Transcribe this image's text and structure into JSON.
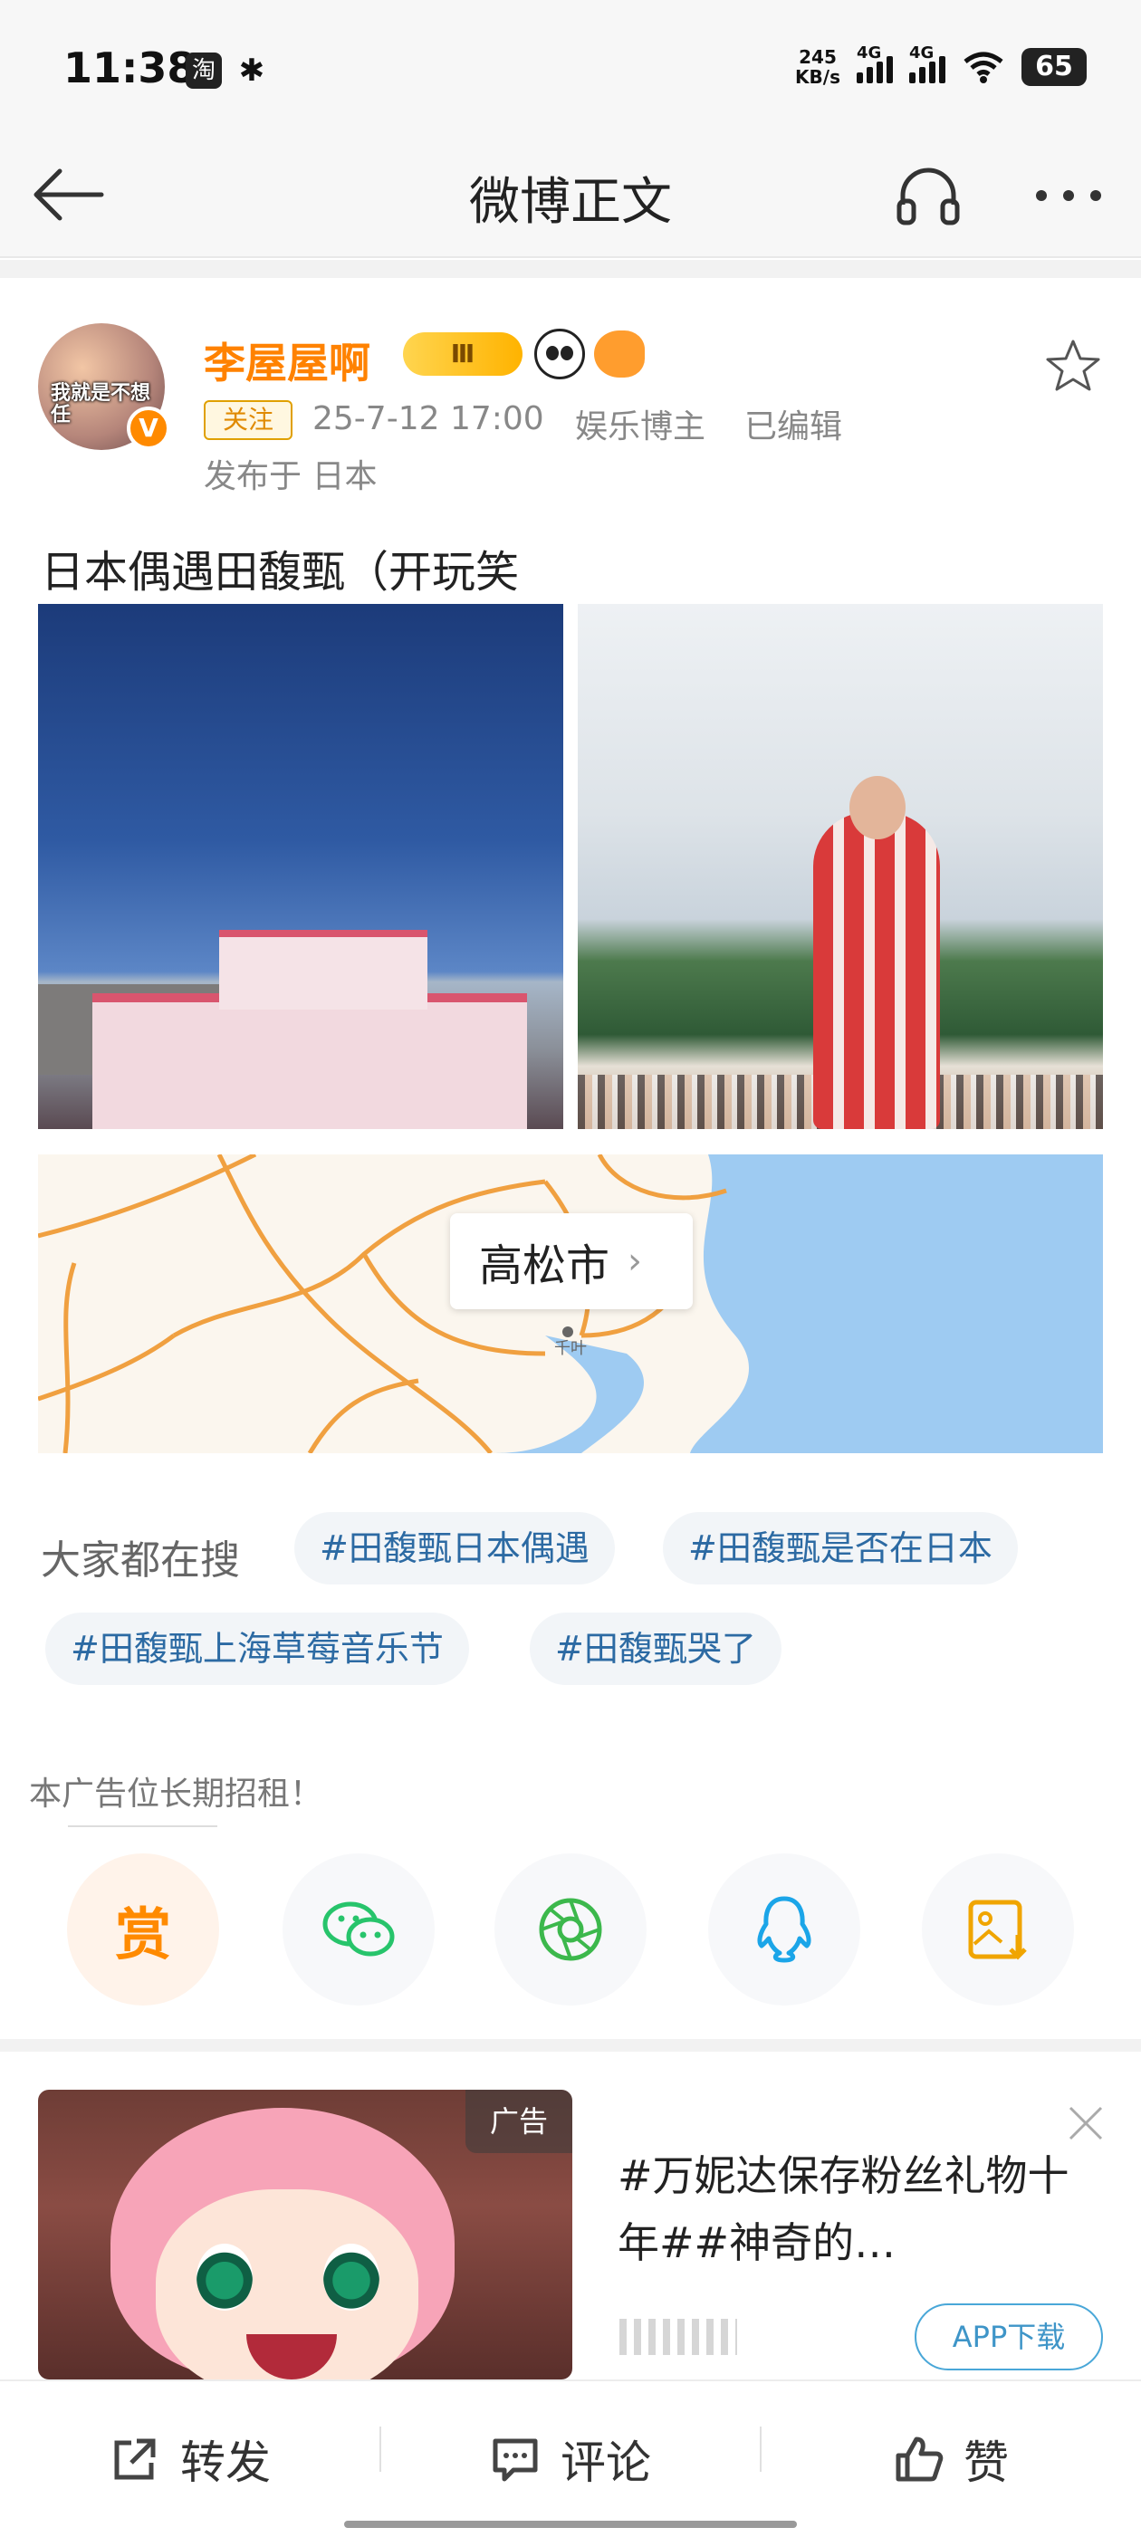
{
  "status_bar": {
    "time": "11:38",
    "app_icons": [
      "淘",
      "小米"
    ],
    "net_speed_value": "245",
    "net_speed_unit": "KB/s",
    "signal_labels": [
      "4G",
      "4G"
    ],
    "battery": "65"
  },
  "nav": {
    "title": "微博正文",
    "icons": [
      "back-arrow-icon",
      "headphone-icon",
      "more-icon"
    ]
  },
  "post": {
    "author": "李屋屋啊",
    "vip_badge": "Ⅲ",
    "avatar_caption": "我就是不想任",
    "avatar_verified": "V",
    "follow_label": "关注",
    "date": "25-7-12 17:00",
    "category": "娱乐博主",
    "edited": "已编辑",
    "location": "发布于 日本",
    "text": "日本偶遇田馥甄（开玩笑",
    "map_label": "高松市",
    "map_chevron": "›",
    "map_pin_text": "千叶"
  },
  "search": {
    "label": "大家都在搜",
    "topics": [
      "#田馥甄日本偶遇",
      "#田馥甄是否在日本",
      "#田馥甄上海草莓音乐节",
      "#田馥甄哭了"
    ]
  },
  "ad_slot": {
    "text": "本广告位长期招租！"
  },
  "share_actions": {
    "reward_label": "赏",
    "icons": [
      "reward-icon",
      "wechat-icon",
      "moments-icon",
      "qq-icon",
      "save-image-icon"
    ]
  },
  "ad_card": {
    "tag": "广告",
    "title": "#万妮达保存粉丝礼物十年##神奇的…",
    "download_label": "APP下载"
  },
  "bottom_bar": {
    "repost": "转发",
    "comment": "评论",
    "like": "赞"
  },
  "colors": {
    "brand_orange": "#ff8200",
    "topic_blue": "#2c6aa3",
    "download_blue": "#3e95c8"
  }
}
